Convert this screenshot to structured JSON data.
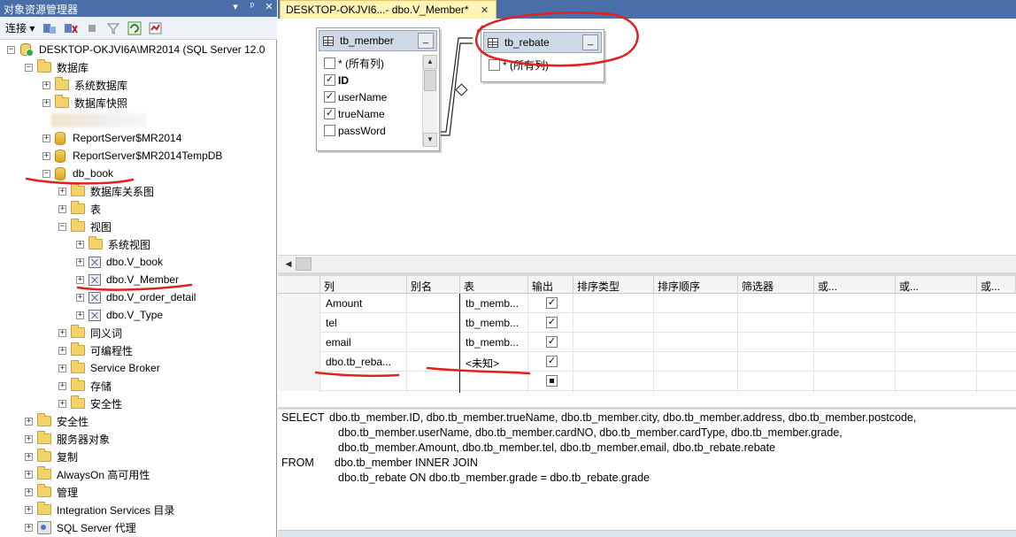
{
  "explorer": {
    "title": "对象资源管理器",
    "title_icons": [
      "▾",
      "ᵖ",
      "✕"
    ],
    "toolbar": {
      "connect_label": "连接 ▾"
    },
    "tree": [
      {
        "id": "server",
        "label": "DESKTOP-OKJVI6A\\MR2014 (SQL Server 12.0",
        "level": 0,
        "exp": "⊟",
        "icon": "server"
      },
      {
        "id": "databases",
        "label": "数据库",
        "level": 1,
        "exp": "⊟",
        "icon": "folder"
      },
      {
        "id": "system-db",
        "label": "系统数据库",
        "level": 2,
        "exp": "⊞",
        "icon": "folder"
      },
      {
        "id": "db-snapshots",
        "label": "数据库快照",
        "level": 2,
        "exp": "⊞",
        "icon": "folder"
      },
      {
        "id": "blurred",
        "label": "",
        "level": 2,
        "exp": "",
        "icon": "blurred"
      },
      {
        "id": "reportserver",
        "label": "ReportServer$MR2014",
        "level": 2,
        "exp": "⊞",
        "icon": "db"
      },
      {
        "id": "reportserver-temp",
        "label": "ReportServer$MR2014TempDB",
        "level": 2,
        "exp": "⊞",
        "icon": "db"
      },
      {
        "id": "db-book",
        "label": "db_book",
        "level": 2,
        "exp": "⊟",
        "icon": "db"
      },
      {
        "id": "db-diagrams",
        "label": "数据库关系图",
        "level": 3,
        "exp": "⊞",
        "icon": "folder"
      },
      {
        "id": "tables",
        "label": "表",
        "level": 3,
        "exp": "⊞",
        "icon": "folder"
      },
      {
        "id": "views",
        "label": "视图",
        "level": 3,
        "exp": "⊟",
        "icon": "folder"
      },
      {
        "id": "system-views",
        "label": "系统视图",
        "level": 4,
        "exp": "⊞",
        "icon": "folder"
      },
      {
        "id": "v-book",
        "label": "dbo.V_book",
        "level": 4,
        "exp": "⊞",
        "icon": "view"
      },
      {
        "id": "v-member",
        "label": "dbo.V_Member",
        "level": 4,
        "exp": "⊞",
        "icon": "view"
      },
      {
        "id": "v-order-detail",
        "label": "dbo.V_order_detail",
        "level": 4,
        "exp": "⊞",
        "icon": "view"
      },
      {
        "id": "v-type",
        "label": "dbo.V_Type",
        "level": 4,
        "exp": "⊞",
        "icon": "view"
      },
      {
        "id": "synonyms",
        "label": "同义词",
        "level": 3,
        "exp": "⊞",
        "icon": "folder"
      },
      {
        "id": "programmability",
        "label": "可编程性",
        "level": 3,
        "exp": "⊞",
        "icon": "folder"
      },
      {
        "id": "service-broker",
        "label": "Service Broker",
        "level": 3,
        "exp": "⊞",
        "icon": "folder"
      },
      {
        "id": "storage",
        "label": "存储",
        "level": 3,
        "exp": "⊞",
        "icon": "folder"
      },
      {
        "id": "db-security",
        "label": "安全性",
        "level": 3,
        "exp": "⊞",
        "icon": "folder"
      },
      {
        "id": "security",
        "label": "安全性",
        "level": 1,
        "exp": "⊞",
        "icon": "folder"
      },
      {
        "id": "server-objects",
        "label": "服务器对象",
        "level": 1,
        "exp": "⊞",
        "icon": "folder"
      },
      {
        "id": "replication",
        "label": "复制",
        "level": 1,
        "exp": "⊞",
        "icon": "folder"
      },
      {
        "id": "alwayson",
        "label": "AlwaysOn 高可用性",
        "level": 1,
        "exp": "⊞",
        "icon": "folder"
      },
      {
        "id": "management",
        "label": "管理",
        "level": 1,
        "exp": "⊞",
        "icon": "folder"
      },
      {
        "id": "integration-services",
        "label": "Integration Services 目录",
        "level": 1,
        "exp": "⊞",
        "icon": "folder"
      },
      {
        "id": "sql-agent",
        "label": "SQL Server 代理",
        "level": 1,
        "exp": "⊞",
        "icon": "agent"
      }
    ]
  },
  "tab": {
    "label": "DESKTOP-OKJVI6...- dbo.V_Member*",
    "close": "✕"
  },
  "diagram": {
    "tb_member": {
      "name": "tb_member",
      "min": "_",
      "columns": [
        {
          "label": "* (所有列)",
          "checked": false,
          "bold": false
        },
        {
          "label": "ID",
          "checked": true,
          "bold": true
        },
        {
          "label": "userName",
          "checked": true,
          "bold": false
        },
        {
          "label": "trueName",
          "checked": true,
          "bold": false
        },
        {
          "label": "passWord",
          "checked": false,
          "bold": false
        }
      ]
    },
    "tb_rebate": {
      "name": "tb_rebate",
      "min": "_",
      "columns": [
        {
          "label": "* (所有列)",
          "checked": false,
          "bold": false
        }
      ]
    }
  },
  "criteria": {
    "headers": [
      "列",
      "别名",
      "表",
      "输出",
      "排序类型",
      "排序顺序",
      "筛选器",
      "或...",
      "或...",
      "或..."
    ],
    "rows": [
      {
        "column": "Amount",
        "alias": "",
        "table": "tb_memb...",
        "output": true
      },
      {
        "column": "tel",
        "alias": "",
        "table": "tb_memb...",
        "output": true
      },
      {
        "column": "email",
        "alias": "",
        "table": "tb_memb...",
        "output": true
      },
      {
        "column": "dbo.tb_reba...",
        "alias": "",
        "table": "<未知>",
        "output": true
      },
      {
        "column": "",
        "alias": "",
        "table": "",
        "output": "partial"
      }
    ]
  },
  "sql": {
    "lines": [
      {
        "keyword": "SELECT",
        "text": "dbo.tb_member.ID, dbo.tb_member.trueName, dbo.tb_member.city, dbo.tb_member.address, dbo.tb_member.postcode,"
      },
      {
        "keyword": "",
        "text": "dbo.tb_member.userName, dbo.tb_member.cardNO, dbo.tb_member.cardType, dbo.tb_member.grade,"
      },
      {
        "keyword": "",
        "text": "dbo.tb_member.Amount, dbo.tb_member.tel, dbo.tb_member.email, dbo.tb_rebate.rebate"
      },
      {
        "keyword": "FROM",
        "text": "dbo.tb_member INNER JOIN"
      },
      {
        "keyword": "",
        "text": "dbo.tb_rebate ON dbo.tb_member.grade = dbo.tb_rebate.grade"
      }
    ]
  },
  "colors": {
    "title_bar": "#4a6ea8",
    "tab_active": "#fff4b8",
    "annotation": "#e0211d"
  }
}
